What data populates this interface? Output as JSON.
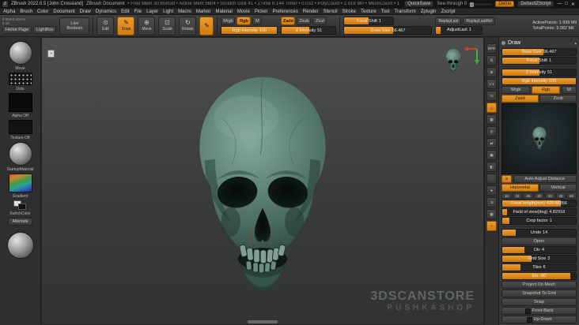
{
  "title_bar": {
    "logo": "Z",
    "app_title": "ZBrush 2022.0.5 [John Crossland]",
    "document_name": "ZBrush Document",
    "stats": "• Free Mem 30.859GB • Active Mem 5604 • Scratch Disk 41 • ZTime 6.144 Timer • 0.032 • PolyCount • 2.919 MP • MeshCount • 1",
    "quicksave_label": "QuickSave",
    "see_through_label": "See-through 0",
    "demo_label": "Demo",
    "zscript_label": "DefaultZScript",
    "window_minimize": "—",
    "window_maximize": "□",
    "window_close": "✕"
  },
  "menu_bar": {
    "items": [
      "Alpha",
      "Brush",
      "Color",
      "Document",
      "Draw",
      "Dynamics",
      "Edit",
      "File",
      "Layer",
      "Light",
      "Macro",
      "Marker",
      "Material",
      "Movie",
      "Picker",
      "Preferences",
      "Render",
      "Stencil",
      "Stroke",
      "Texture",
      "Tool",
      "Transform",
      "Zplugin",
      "Zscript"
    ]
  },
  "top_shelf": {
    "coords_line1": "0.004-0.405-N",
    "coords_line2": "0.34",
    "home_page": "Home Page",
    "lightbox": "LightBox",
    "live_boolean": "Live Boolean",
    "edit": "Edit",
    "draw": "Draw",
    "move": "Move",
    "scale": "Scale",
    "rotate": "Rotate",
    "mrgb": "Mrgb",
    "rgb": "Rgb",
    "m": "M",
    "zadd": "Zadd",
    "zsub": "Zsub",
    "zcut": "Zcut",
    "rgb_intensity_label": "Rgb Intensity",
    "rgb_intensity_value": "100",
    "z_intensity_label": "Z Intensity",
    "z_intensity_value": "51",
    "focal_shift_label": "Focal Shift",
    "focal_shift_value": "1",
    "draw_size_label": "Draw Size",
    "draw_size_value": "56.467",
    "replay_last": "ReplayLast",
    "replay_last_rel": "ReplayLastRel",
    "adjust_last_label": "AdjustLast",
    "adjust_last_value": "1",
    "active_points": "ActivePoints: 1.999 Mil",
    "total_points": "TotalPoints: 5.082 Mil"
  },
  "left_shelf": {
    "brush_label": "Move",
    "stroke_label": "Dots",
    "alpha_label": "Alpha Off",
    "texture_label": "Texture Off",
    "material_label": "StartupMaterial",
    "gradient_label": "Gradient",
    "switch_color_label": "SwitchColor",
    "alternate_label": "Alternate"
  },
  "canvas": {
    "watermark_line1": "3DSCANSTORE",
    "watermark_line2": "PUSHKASHOP"
  },
  "right_shelf": {
    "icons": [
      {
        "name": "bpr",
        "glyph": "BPR"
      },
      {
        "name": "scroll-document",
        "glyph": "⇅"
      },
      {
        "name": "zoom-document",
        "glyph": "⊕"
      },
      {
        "name": "actual-size",
        "glyph": "1:1"
      },
      {
        "name": "aa-half",
        "glyph": "½"
      },
      {
        "name": "persp",
        "glyph": "△",
        "active": true
      },
      {
        "name": "floor",
        "glyph": "▦"
      },
      {
        "name": "local-transform",
        "glyph": "◎"
      },
      {
        "name": "lsym",
        "glyph": "⇄"
      },
      {
        "name": "frame",
        "glyph": "▣"
      },
      {
        "name": "transp",
        "glyph": "◧"
      },
      {
        "name": "ghost",
        "glyph": "◌"
      },
      {
        "name": "solo",
        "glyph": "●"
      },
      {
        "name": "xpose",
        "glyph": "⇉"
      },
      {
        "name": "polyframe",
        "glyph": "▩"
      },
      {
        "name": "gizmo",
        "glyph": "+",
        "active": true
      }
    ]
  },
  "draw_panel": {
    "title": "Draw",
    "draw_size_label": "Draw Size",
    "draw_size_value": "56.467",
    "focal_shift_label": "Focal Shift",
    "focal_shift_value": "1",
    "z_intensity_label": "Z Intensity",
    "z_intensity_value": "51",
    "rgb_intensity_label": "Rgb Intensity",
    "rgb_intensity_value": "100",
    "mrgb": "Mrgb",
    "rgb": "Rgb",
    "m": "M",
    "zadd": "Zadd",
    "zsub": "Zsub",
    "stored_view_glyph": "≡",
    "auto_adjust": "Auto Adjust Distance",
    "horizontal": "Horizontal",
    "vertical": "Vertical",
    "focal_presets": [
      "18",
      "24",
      "28",
      "30",
      "32",
      "45",
      "60"
    ],
    "focal_length_label": "Focal length(mm)",
    "focal_length_value": "426.86856",
    "fov_label": "Field of view(deg)",
    "fov_value": "4.82918",
    "crop_label": "Crop factor",
    "crop_value": "1",
    "undo_label": "Undo",
    "undo_value": "14",
    "open_label": "Open",
    "div_label": "Div",
    "div_value": "4",
    "grid_size_label": "Grid Size",
    "grid_size_value": "3",
    "tiles_label": "Tiles",
    "tiles_value": "6",
    "elv_label": "Elv",
    "elv_value": "-90",
    "project_label": "Project On Mesh",
    "snapshot_label": "Snapshot To Grid",
    "snap_label": "Snap",
    "front_back_label": "Front-Back",
    "up_down_label": "Up-Down"
  }
}
